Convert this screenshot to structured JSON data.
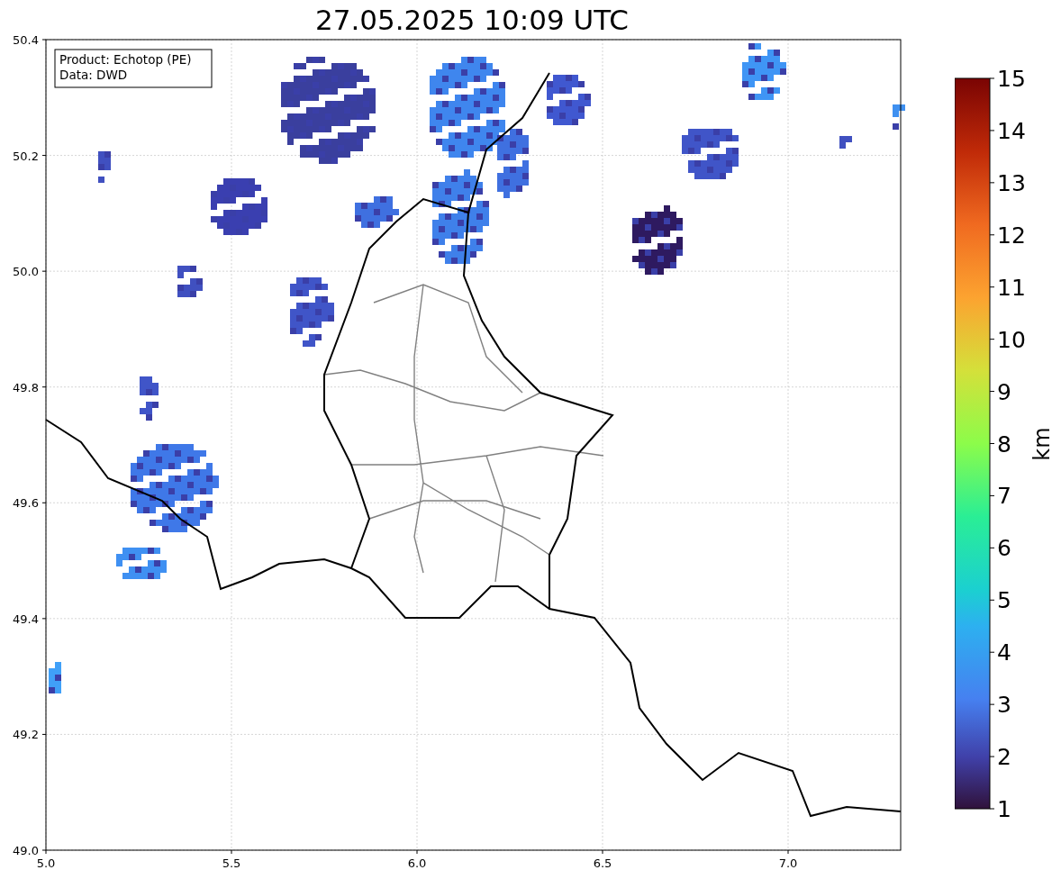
{
  "title": "27.05.2025 10:09 UTC",
  "info_box": [
    "Product: Echotop (PE)",
    "Data: DWD"
  ],
  "x_ticks": [
    "5.0",
    "5.5",
    "6.0",
    "6.5",
    "7.0"
  ],
  "y_ticks": [
    "50.4",
    "50.2",
    "50.0",
    "49.8",
    "49.6",
    "49.4",
    "49.2",
    "49.0"
  ],
  "colorbar": {
    "ticks": [
      "15",
      "14",
      "13",
      "12",
      "11",
      "10",
      "9",
      "8",
      "7",
      "6",
      "5",
      "4",
      "3",
      "2",
      "1"
    ],
    "label": "km"
  }
}
